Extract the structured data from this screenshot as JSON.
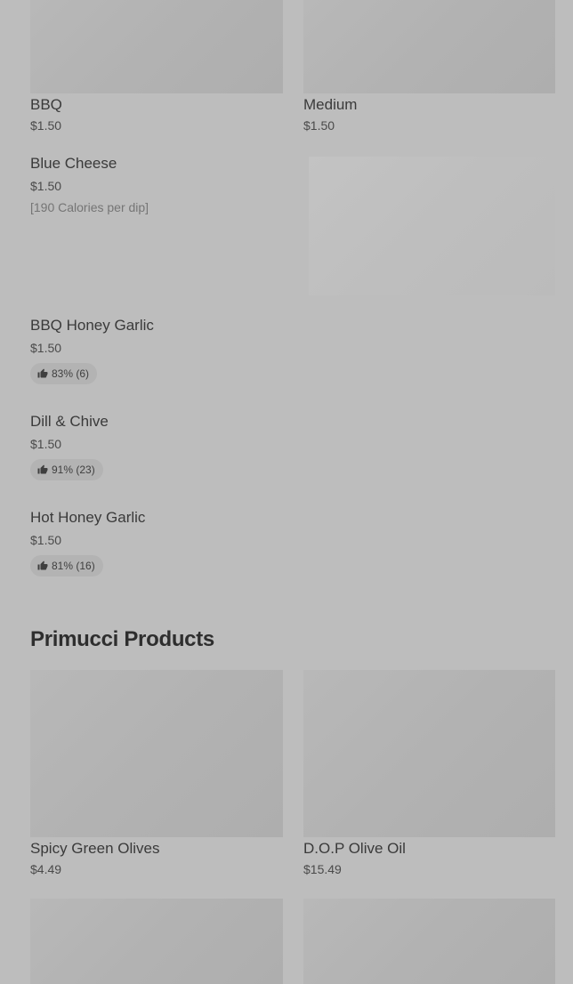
{
  "top_items": [
    {
      "name": "BBQ",
      "price": "$1.50"
    },
    {
      "name": "Medium",
      "price": "$1.50"
    }
  ],
  "list_items": [
    {
      "name": "Blue Cheese",
      "price": "$1.50",
      "calories": "[190 Calories per dip]"
    },
    {
      "name": "BBQ Honey Garlic",
      "price": "$1.50",
      "rating": "83% (6)"
    },
    {
      "name": "Dill & Chive",
      "price": "$1.50",
      "rating": "91% (23)"
    },
    {
      "name": "Hot Honey Garlic",
      "price": "$1.50",
      "rating": "81% (16)"
    }
  ],
  "section": {
    "title": "Primucci Products",
    "items": [
      {
        "name": "Spicy Green Olives",
        "price": "$4.49"
      },
      {
        "name": "D.O.P Olive Oil",
        "price": "$15.49"
      }
    ]
  },
  "icons": {
    "rating": "thumbs-up-icon"
  },
  "colors": {
    "background": "#bdbdbd",
    "image_placeholder": "#b2b2b2"
  }
}
